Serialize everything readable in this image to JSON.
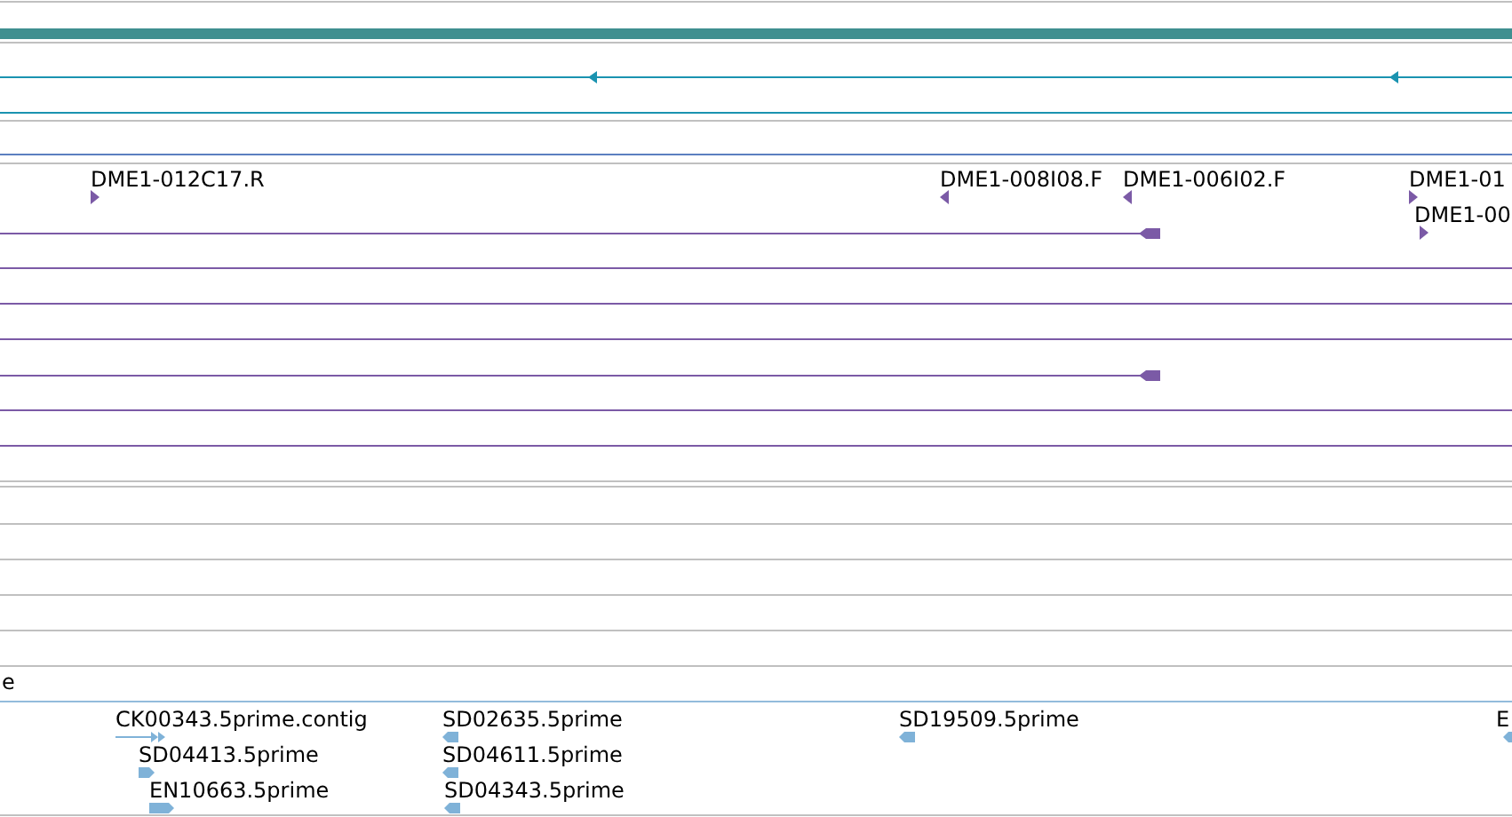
{
  "tracks": [
    {
      "kind": "clones",
      "features": [
        {
          "label": "DME1-012C17.R",
          "reverse": false
        },
        {
          "label": "DME1-008I08.F",
          "reverse": true
        },
        {
          "label": "DME1-006I02.F",
          "reverse": true
        },
        {
          "label": "DME1-01",
          "reverse": false
        },
        {
          "label": "DME1-00",
          "reverse": false
        }
      ]
    },
    {
      "kind": "partial",
      "features": [
        {
          "label": "e"
        }
      ]
    },
    {
      "kind": "ests",
      "features": [
        {
          "label": "CK00343.5prime.contig",
          "reverse": false
        },
        {
          "label": "SD04413.5prime",
          "reverse": false
        },
        {
          "label": "EN10663.5prime",
          "reverse": false
        },
        {
          "label": "SD02635.5prime",
          "reverse": true
        },
        {
          "label": "SD04611.5prime",
          "reverse": true
        },
        {
          "label": "SD04343.5prime",
          "reverse": true
        },
        {
          "label": "SD19509.5prime",
          "reverse": true
        },
        {
          "label": "E",
          "reverse": true
        }
      ]
    }
  ]
}
